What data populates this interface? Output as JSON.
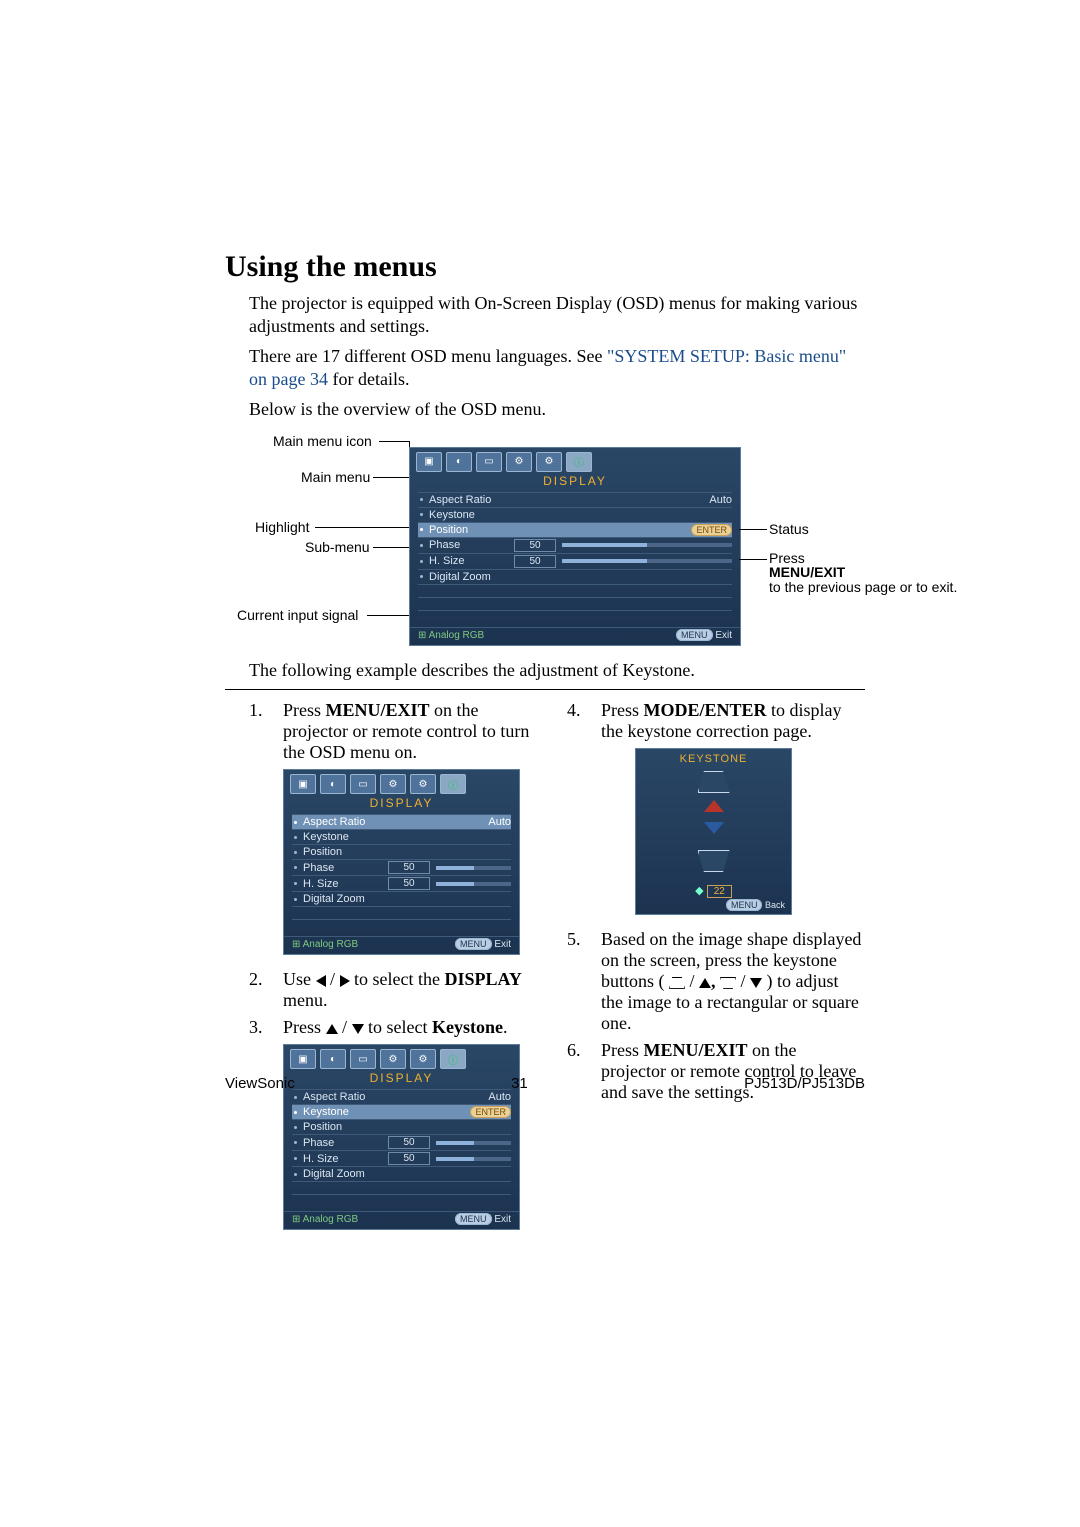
{
  "heading": "Using the menus",
  "intro1": "The projector is equipped with On-Screen Display (OSD) menus for making various adjustments and settings.",
  "intro2a": "There are 17 different OSD menu languages. See ",
  "intro2link": "\"SYSTEM SETUP: Basic menu\" on page 34",
  "intro2b": " for details.",
  "intro3": "Below is the overview of the OSD menu.",
  "labels": {
    "mainMenuIcon": "Main menu icon",
    "mainMenu": "Main menu",
    "highlight": "Highlight",
    "subMenu": "Sub-menu",
    "currentInput": "Current input signal",
    "status": "Status",
    "pressMenu1": "Press",
    "pressMenu2": "MENU/EXIT",
    "pressMenu3": "to the previous page or to exit."
  },
  "osd": {
    "title": "DISPLAY",
    "rows": {
      "aspect": "Aspect Ratio",
      "keystone": "Keystone",
      "position": "Position",
      "phase": "Phase",
      "hsize": "H. Size",
      "zoom": "Digital Zoom"
    },
    "vals": {
      "auto": "Auto",
      "enter": "ENTER",
      "fifty": "50"
    },
    "footerSignal": "Analog RGB",
    "footerMenu": "MENU",
    "footerExit": "Exit",
    "footerBack": "Back"
  },
  "example": "The following example describes the adjustment of Keystone.",
  "steps": {
    "s1a": "Press ",
    "s1b": "MENU/EXIT",
    "s1c": " on the projector or remote control to turn the OSD menu on.",
    "s2a": "Use ",
    "s2b": " to select the ",
    "s2c": "DISPLAY",
    "s2d": " menu.",
    "s3a": "Press ",
    "s3b": " to select ",
    "s3c": "Keystone",
    "s3d": ".",
    "s4a": "Press ",
    "s4b": "MODE/ENTER",
    "s4c": " to display the keystone correction page.",
    "s5a": "Based on the image shape displayed on the screen, press the keystone buttons ( ",
    "s5b": " ) to adjust the image to a rectangular or square one.",
    "s6a": "Press ",
    "s6b": "MENU/EXIT",
    "s6c": " on the projector or remote control to leave and save the settings."
  },
  "keystone": {
    "title": "KEYSTONE",
    "value": "22"
  },
  "footer": {
    "brand": "ViewSonic",
    "page": "31",
    "model": "PJ513D/PJ513DB"
  }
}
